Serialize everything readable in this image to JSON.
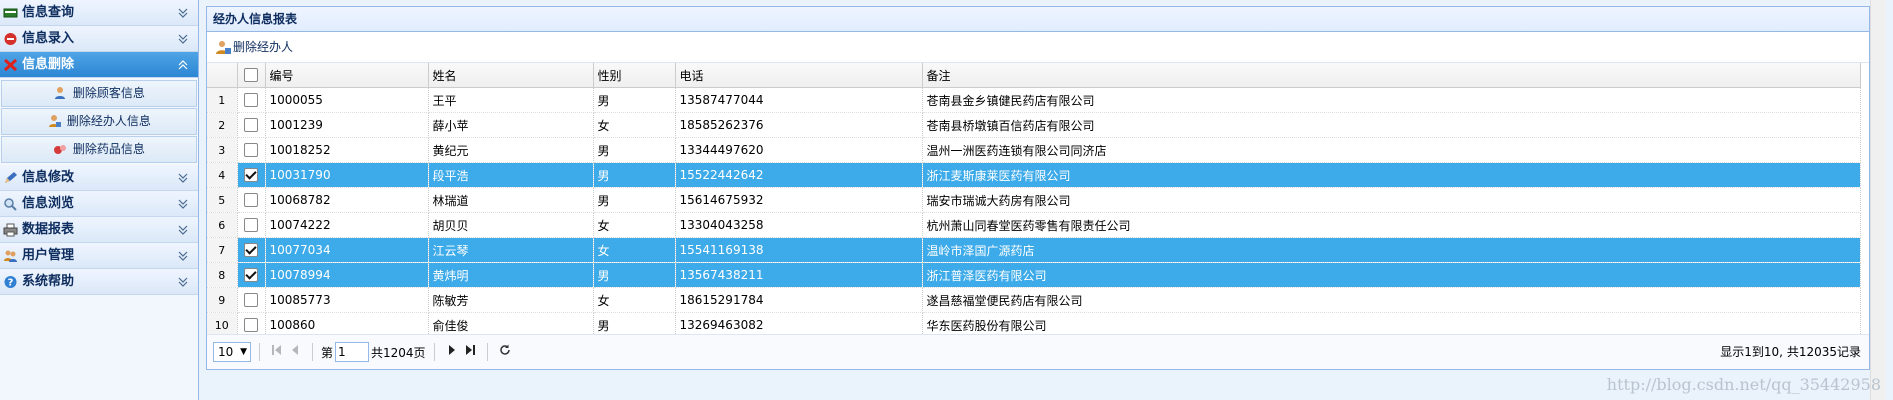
{
  "sidebar": {
    "menus": [
      {
        "label": "信息查询",
        "icon": "credit-card-icon",
        "expanded": false
      },
      {
        "label": "信息录入",
        "icon": "red-circle-icon",
        "expanded": false
      },
      {
        "label": "信息删除",
        "icon": "red-x-icon",
        "expanded": true,
        "items": [
          {
            "label": "删除顾客信息",
            "icon": "person-icon"
          },
          {
            "label": "删除经办人信息",
            "icon": "agent-icon"
          },
          {
            "label": "删除药品信息",
            "icon": "pills-icon"
          }
        ]
      },
      {
        "label": "信息修改",
        "icon": "pencil-icon",
        "expanded": false
      },
      {
        "label": "信息浏览",
        "icon": "magnifier-icon",
        "expanded": false
      },
      {
        "label": "数据报表",
        "icon": "printer-icon",
        "expanded": false
      },
      {
        "label": "用户管理",
        "icon": "users-icon",
        "expanded": false
      },
      {
        "label": "系统帮助",
        "icon": "help-icon",
        "expanded": false
      }
    ]
  },
  "panel": {
    "title": "经办人信息报表",
    "toolbar": {
      "delete_label": "删除经办人"
    },
    "columns": [
      "编号",
      "姓名",
      "性别",
      "电话",
      "备注"
    ],
    "rows": [
      {
        "n": "1",
        "id": "1000055",
        "name": "王平",
        "sex": "男",
        "phone": "13587477044",
        "note": "苍南县金乡镇健民药店有限公司",
        "checked": false
      },
      {
        "n": "2",
        "id": "1001239",
        "name": "薛小苹",
        "sex": "女",
        "phone": "18585262376",
        "note": "苍南县桥墩镇百信药店有限公司",
        "checked": false
      },
      {
        "n": "3",
        "id": "10018252",
        "name": "黄纪元",
        "sex": "男",
        "phone": "13344497620",
        "note": "温州一洲医药连锁有限公司同济店",
        "checked": false
      },
      {
        "n": "4",
        "id": "10031790",
        "name": "段平浩",
        "sex": "男",
        "phone": "15522442642",
        "note": "浙江麦斯康莱医药有限公司",
        "checked": true
      },
      {
        "n": "5",
        "id": "10068782",
        "name": "林瑞道",
        "sex": "男",
        "phone": "15614675932",
        "note": "瑞安市瑞诚大药房有限公司",
        "checked": false
      },
      {
        "n": "6",
        "id": "10074222",
        "name": "胡贝贝",
        "sex": "女",
        "phone": "13304043258",
        "note": "杭州萧山同春堂医药零售有限责任公司",
        "checked": false
      },
      {
        "n": "7",
        "id": "10077034",
        "name": "江云琴",
        "sex": "女",
        "phone": "15541169138",
        "note": "温岭市泽国广源药店",
        "checked": true
      },
      {
        "n": "8",
        "id": "10078994",
        "name": "黄炜明",
        "sex": "男",
        "phone": "13567438211",
        "note": "浙江普泽医药有限公司",
        "checked": true
      },
      {
        "n": "9",
        "id": "10085773",
        "name": "陈敏芳",
        "sex": "女",
        "phone": "18615291784",
        "note": "遂昌慈福堂便民药店有限公司",
        "checked": false
      },
      {
        "n": "10",
        "id": "100860",
        "name": "俞佳俊",
        "sex": "男",
        "phone": "13269463082",
        "note": "华东医药股份有限公司",
        "checked": false
      }
    ],
    "pager": {
      "page_size": "10",
      "page_prefix": "第",
      "page_value": "1",
      "page_total": "共1204页",
      "info": "显示1到10, 共12035记录"
    }
  },
  "watermark": "http://blog.csdn.net/qq_35442958",
  "colors": {
    "selected_row": "#3daae9",
    "active_menu": "#2b86d2",
    "border": "#95b8e7"
  }
}
